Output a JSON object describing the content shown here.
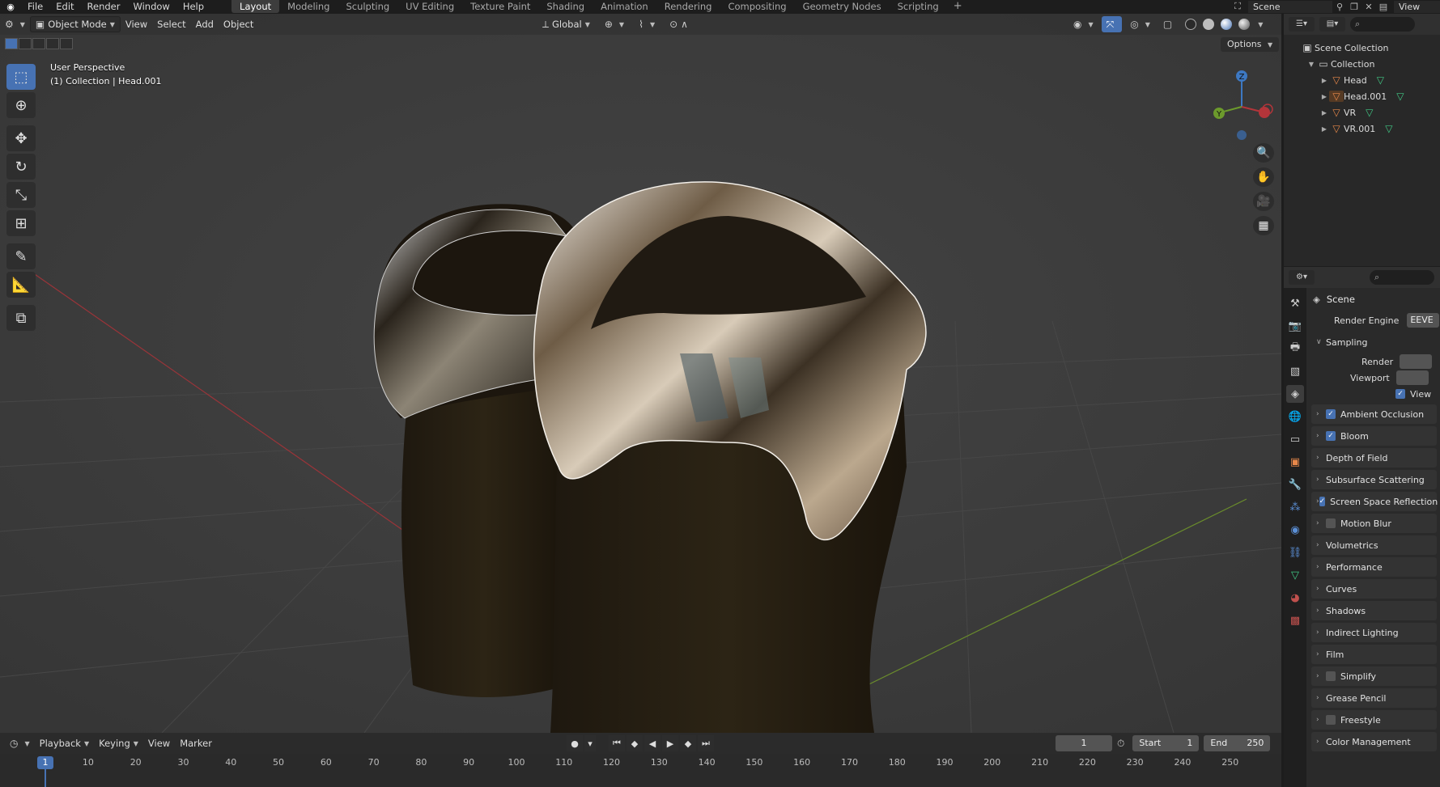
{
  "topbar": {
    "logo": "blender-logo",
    "menus": [
      "File",
      "Edit",
      "Render",
      "Window",
      "Help"
    ],
    "workspaces": [
      "Layout",
      "Modeling",
      "Sculpting",
      "UV Editing",
      "Texture Paint",
      "Shading",
      "Animation",
      "Rendering",
      "Compositing",
      "Geometry Nodes",
      "Scripting"
    ],
    "active_workspace": "Layout",
    "add_workspace": "+",
    "scene_name": "Scene",
    "view_layer_label": "View"
  },
  "viewport": {
    "mode_label": "Object Mode",
    "menus": [
      "View",
      "Select",
      "Add",
      "Object"
    ],
    "transform_orientation": "Global",
    "options_label": "Options",
    "info_line1": "User Perspective",
    "info_line2": "(1) Collection | Head.001",
    "gizmo_axes": {
      "x": "X",
      "y": "Y",
      "z": "Z"
    },
    "colors": {
      "background": "#3d3d3d",
      "x_axis": "#b3353a",
      "y_axis": "#6c9a2c",
      "z_axis": "#3d78c2",
      "active": "#4772b3"
    }
  },
  "toolbar": {
    "tools": [
      "select-box-icon",
      "cursor-icon",
      "move-icon",
      "rotate-icon",
      "scale-icon",
      "transform-icon",
      "annotate-icon",
      "measure-icon",
      "add-cube-icon"
    ]
  },
  "timeline": {
    "menus": [
      "Playback",
      "Keying",
      "View",
      "Marker"
    ],
    "current_frame": "1",
    "start_label": "Start",
    "start_value": "1",
    "end_label": "End",
    "end_value": "250",
    "ruler_ticks": [
      "1",
      "10",
      "20",
      "30",
      "40",
      "50",
      "60",
      "70",
      "80",
      "90",
      "100",
      "110",
      "120",
      "130",
      "140",
      "150",
      "160",
      "170",
      "180",
      "190",
      "200",
      "210",
      "220",
      "230",
      "240",
      "250"
    ]
  },
  "outliner": {
    "scene_collection": "Scene Collection",
    "collection": "Collection",
    "objects": [
      "Head",
      "Head.001",
      "VR",
      "VR.001"
    ]
  },
  "properties": {
    "scene_label": "Scene",
    "render_engine_label": "Render Engine",
    "render_engine_value": "EEVE",
    "sampling_label": "Sampling",
    "render_label": "Render",
    "viewport_label": "Viewport",
    "viewport_denoise_label": "View",
    "panels": [
      {
        "label": "Ambient Occlusion",
        "checkbox": true,
        "checked": true
      },
      {
        "label": "Bloom",
        "checkbox": true,
        "checked": true
      },
      {
        "label": "Depth of Field",
        "checkbox": false,
        "checked": false
      },
      {
        "label": "Subsurface Scattering",
        "checkbox": false,
        "checked": false
      },
      {
        "label": "Screen Space Reflection",
        "checkbox": true,
        "checked": true
      },
      {
        "label": "Motion Blur",
        "checkbox": true,
        "checked": false
      },
      {
        "label": "Volumetrics",
        "checkbox": false,
        "checked": false
      },
      {
        "label": "Performance",
        "checkbox": false,
        "checked": false
      },
      {
        "label": "Curves",
        "checkbox": false,
        "checked": false
      },
      {
        "label": "Shadows",
        "checkbox": false,
        "checked": false
      },
      {
        "label": "Indirect Lighting",
        "checkbox": false,
        "checked": false
      },
      {
        "label": "Film",
        "checkbox": false,
        "checked": false
      },
      {
        "label": "Simplify",
        "checkbox": true,
        "checked": false
      },
      {
        "label": "Grease Pencil",
        "checkbox": false,
        "checked": false
      },
      {
        "label": "Freestyle",
        "checkbox": true,
        "checked": false
      },
      {
        "label": "Color Management",
        "checkbox": false,
        "checked": false
      }
    ]
  }
}
